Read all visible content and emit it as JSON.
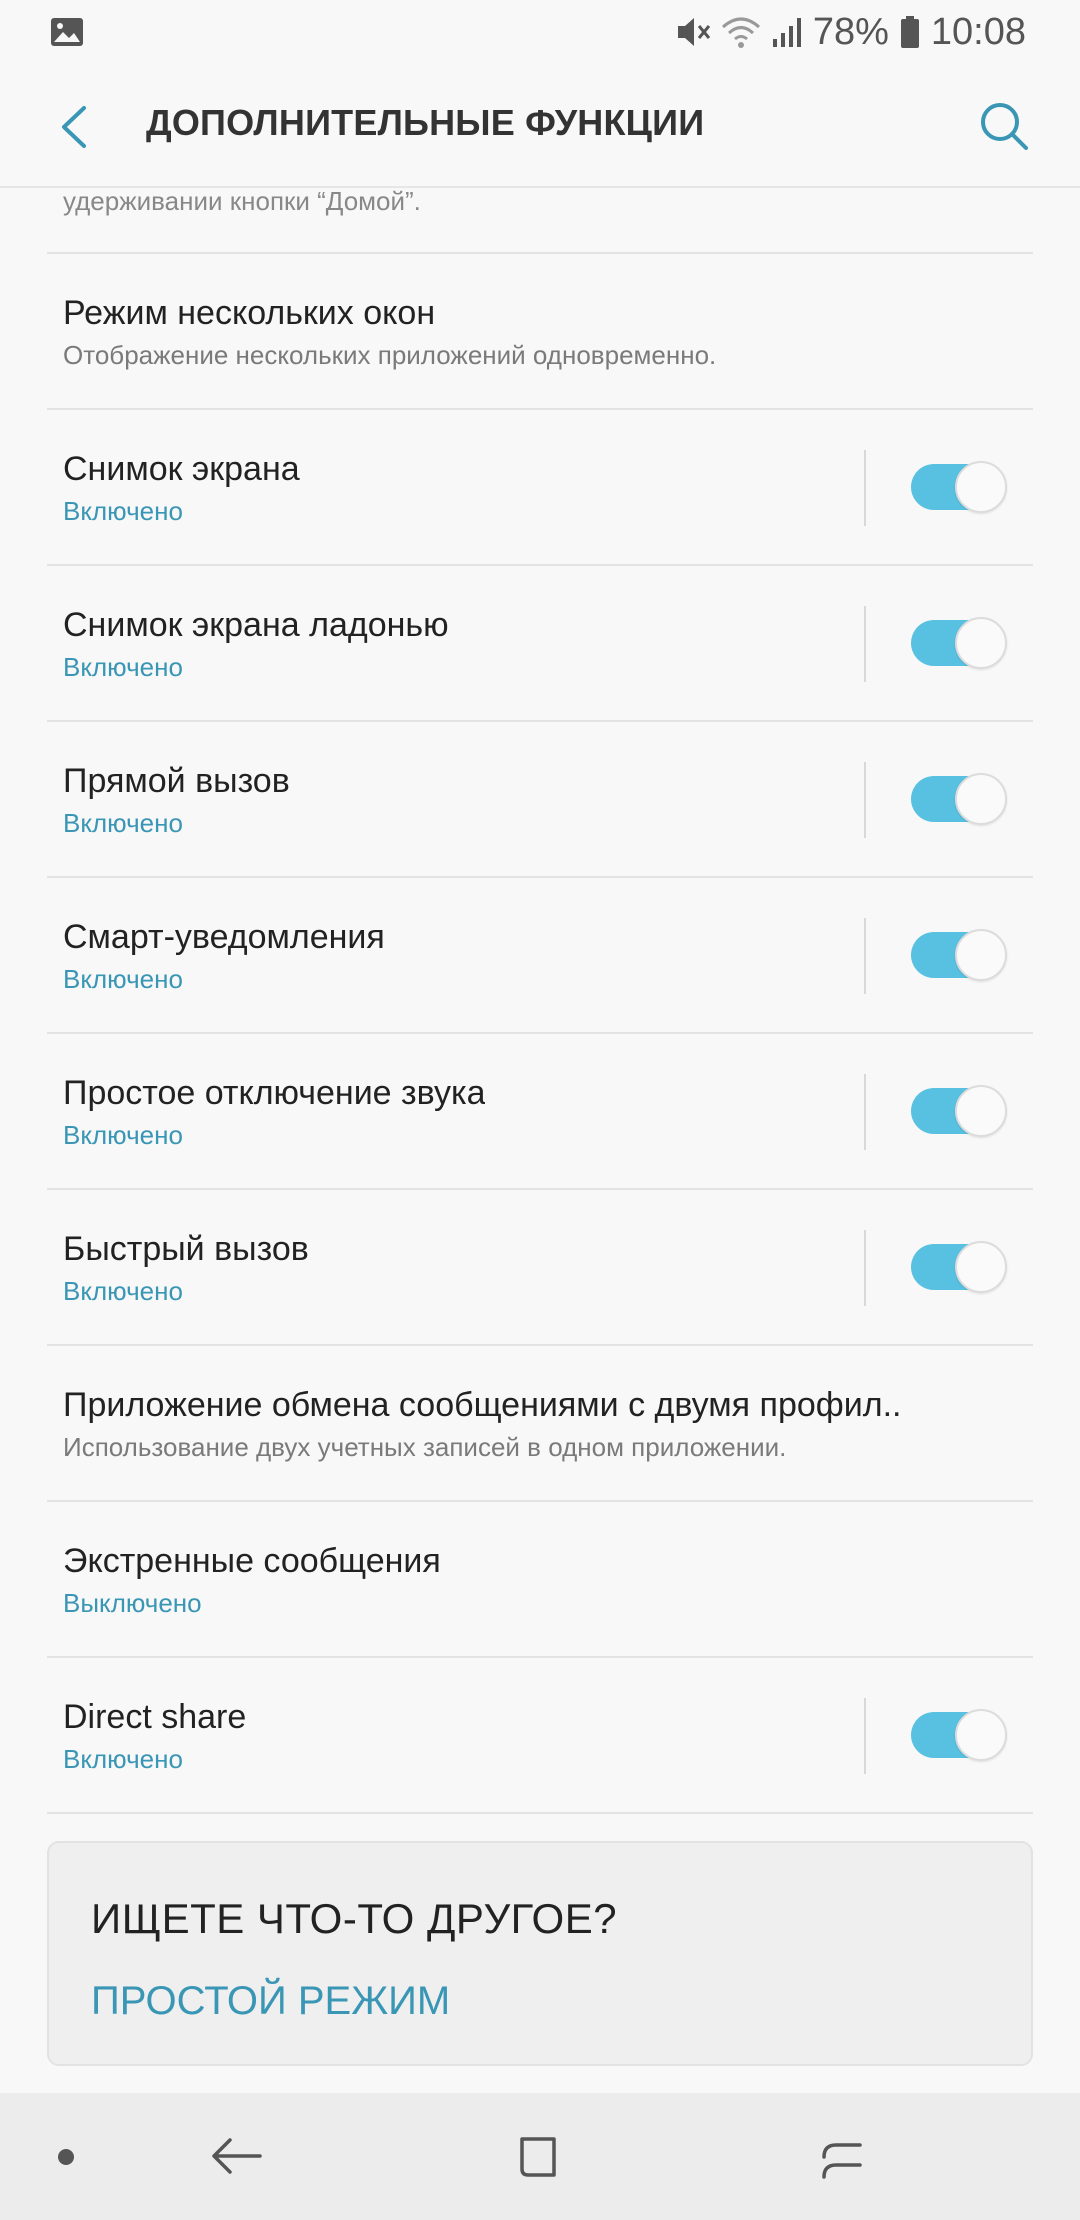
{
  "statusbar": {
    "battery": "78%",
    "time": "10:08",
    "icons": [
      "gallery-icon",
      "mute-icon",
      "wifi-icon",
      "signal-icon",
      "battery-icon"
    ]
  },
  "header": {
    "title": "ДОПОЛНИТЕЛЬНЫЕ ФУНКЦИИ",
    "icons": [
      "back-arrow-icon",
      "search-icon"
    ]
  },
  "list": {
    "clipped_text": "удерживании кнопки “Домой”.",
    "items": [
      {
        "title": "Режим нескольких окон",
        "subtitle": "Отображение нескольких приложений одновременно.",
        "toggle": null
      },
      {
        "title": "Снимок экрана",
        "subtitle": "Включено",
        "toggle": true
      },
      {
        "title": "Снимок экрана ладонью",
        "subtitle": "Включено",
        "toggle": true
      },
      {
        "title": "Прямой вызов",
        "subtitle": "Включено",
        "toggle": true
      },
      {
        "title": "Смарт-уведомления",
        "subtitle": "Включено",
        "toggle": true
      },
      {
        "title": "Простое отключение звука",
        "subtitle": "Включено",
        "toggle": true
      },
      {
        "title": "Быстрый вызов",
        "subtitle": "Включено",
        "toggle": true
      },
      {
        "title": "Приложение обмена сообщениями с двумя профил..",
        "subtitle": "Использование двух учетных записей в одном приложении.",
        "toggle": null
      },
      {
        "title": "Экстренные сообщения",
        "subtitle": "Выключено",
        "toggle": null
      },
      {
        "title": "Direct share",
        "subtitle": "Включено",
        "toggle": true
      }
    ]
  },
  "card": {
    "title": "ИЩЕТЕ ЧТО-ТО ДРУГОЕ?",
    "link": "ПРОСТОЙ РЕЖИМ"
  },
  "navbar": {
    "icons": [
      "dot-icon",
      "back-icon",
      "home-icon",
      "recents-icon"
    ]
  },
  "colors": {
    "accent": "#3a96b5",
    "toggle_on": "#58c1e1",
    "background": "#f8f8f8"
  }
}
